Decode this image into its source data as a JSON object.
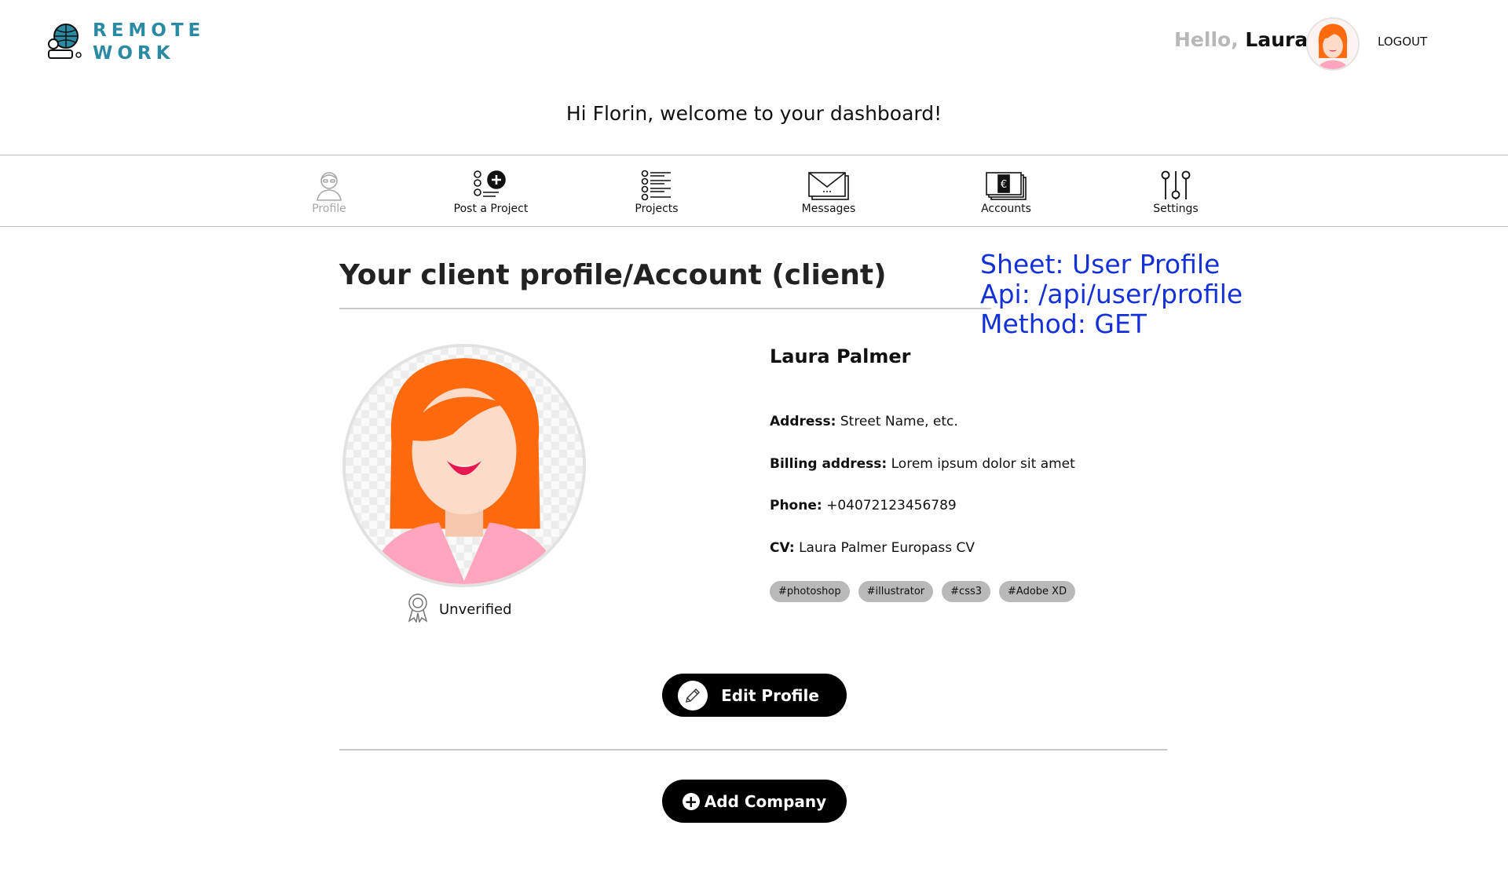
{
  "header": {
    "logo_line1": "REMOTE",
    "logo_line2": "WORK",
    "greeting": "Hello,",
    "user_name": "Laura",
    "logout_label": "LOGOUT"
  },
  "welcome": "Hi Florin, welcome to your dashboard!",
  "nav": [
    {
      "label": "Profile",
      "icon": "user-icon"
    },
    {
      "label": "Post a Project",
      "icon": "post-project-icon"
    },
    {
      "label": "Projects",
      "icon": "list-icon"
    },
    {
      "label": "Messages",
      "icon": "envelope-icon"
    },
    {
      "label": "Accounts",
      "icon": "euro-cards-icon"
    },
    {
      "label": "Settings",
      "icon": "sliders-icon"
    }
  ],
  "page_title": "Your client profile/Account (client)",
  "annotation": "Sheet: User Profile\nApi: /api/user/profile\nMethod: GET",
  "profile": {
    "full_name": "Laura Palmer",
    "status": "Unverified",
    "fields": [
      {
        "label": "Address:",
        "value": "Street Name, etc."
      },
      {
        "label": "Billing address:",
        "value": "Lorem ipsum dolor sit amet"
      },
      {
        "label": "Phone:",
        "value": "+04072123456789"
      },
      {
        "label": "CV:",
        "value": "Laura Palmer Europass CV"
      }
    ],
    "tags": [
      "#photoshop",
      "#illustrator",
      "#css3",
      "#Adobe XD"
    ]
  },
  "buttons": {
    "edit_profile": "Edit Profile",
    "add_company": "Add Company"
  },
  "colors": {
    "brand": "#2b8aa3",
    "annotation": "#1431d6",
    "hair": "#ff6a0f",
    "button": "#000000"
  }
}
